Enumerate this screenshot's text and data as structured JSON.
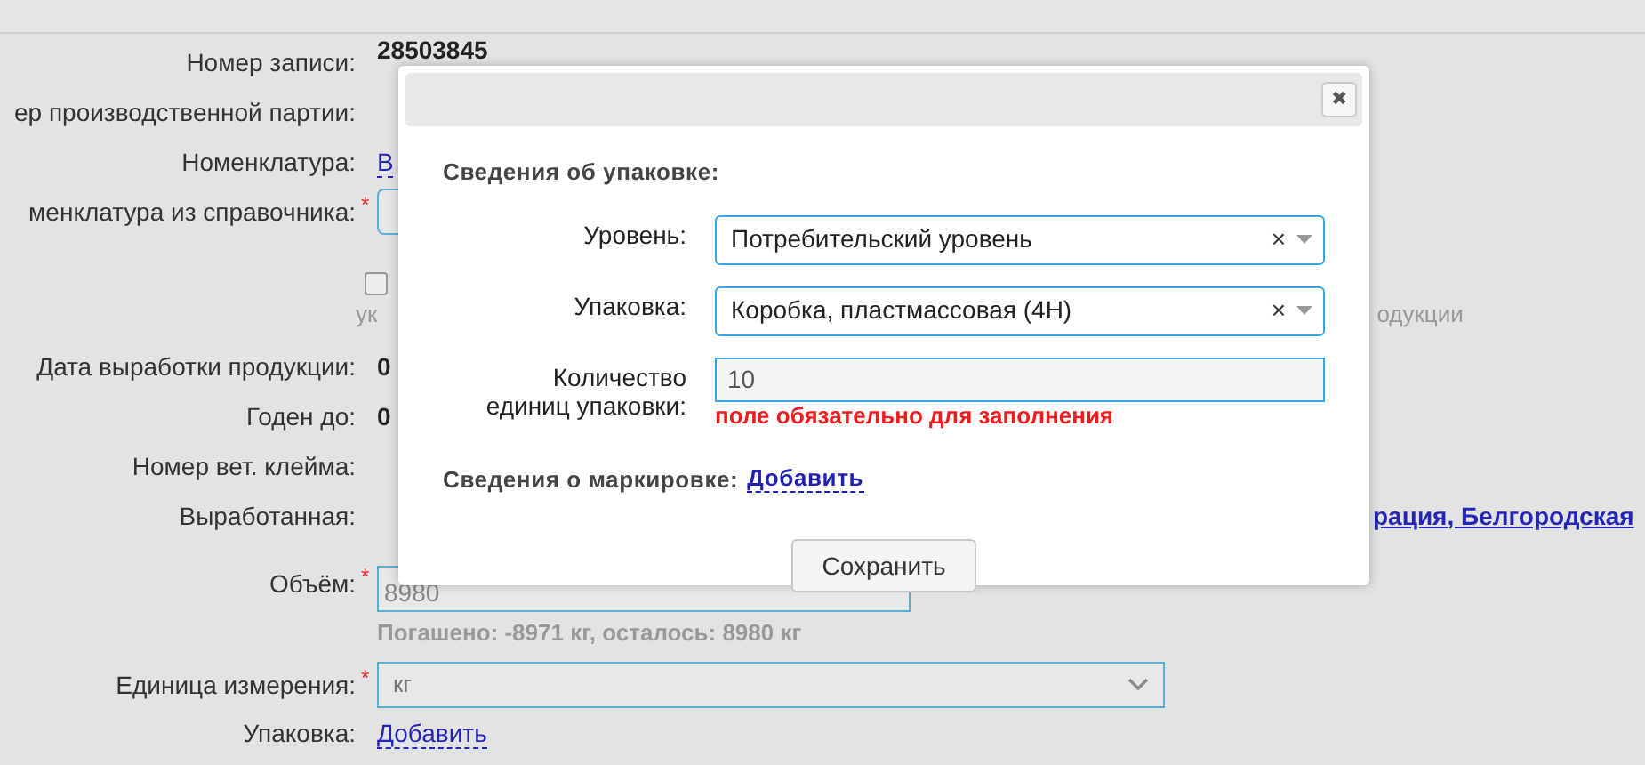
{
  "background_form": {
    "rows": [
      {
        "kind": "text",
        "label": "Номер записи:",
        "value": "28503845"
      },
      {
        "kind": "text",
        "label": "ер производственной партии:"
      },
      {
        "kind": "link",
        "label": "Номенклатура:",
        "value": "В"
      },
      {
        "kind": "field",
        "label": "менклатура из справочника:",
        "required_mark": "*"
      },
      {
        "kind": "checkbox",
        "checked": false,
        "hint_left": "ук",
        "hint_right": "одукции"
      },
      {
        "kind": "text",
        "label": "Дата выработки продукции:",
        "value": "0"
      },
      {
        "kind": "text",
        "label": "Годен до:",
        "value": "0"
      },
      {
        "kind": "text",
        "label": "Номер вет. клейма:"
      },
      {
        "kind": "far_link",
        "label": "Выработанная:",
        "value": "рация, Белгородская"
      },
      {
        "kind": "field",
        "label": "Объём:",
        "required_mark": "*",
        "value": "8980",
        "hint": "Погашено: -8971 кг, осталось: 8980 кг"
      },
      {
        "kind": "select",
        "label": "Единица измерения:",
        "required_mark": "*",
        "value": "кг"
      },
      {
        "kind": "link",
        "label": "Упаковка:",
        "value": "Добавить"
      }
    ]
  },
  "dialog": {
    "close": "✖",
    "section_title": "Сведения об упаковке:",
    "fields": [
      {
        "kind": "select",
        "label": "Уровень:",
        "value": "Потребительский уровень",
        "clear": "×"
      },
      {
        "kind": "select",
        "label": "Упаковка:",
        "value": "Коробка, пластмассовая (4Н)",
        "clear": "×"
      },
      {
        "kind": "input",
        "label": "Количество единиц упаковки:",
        "value": "10",
        "error": "поле обязательно для заполнения"
      }
    ],
    "marking": {
      "label": "Сведения о маркировке:",
      "link": "Добавить"
    },
    "save_button": "Сохранить"
  }
}
